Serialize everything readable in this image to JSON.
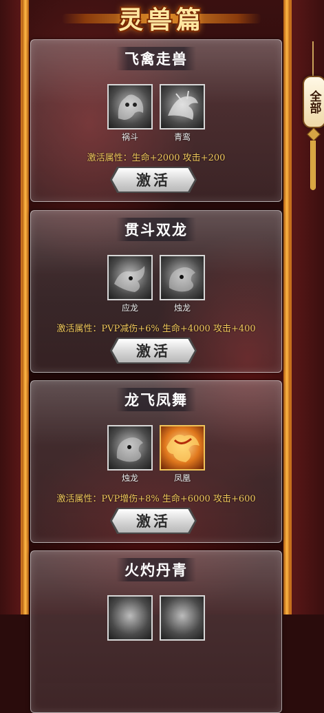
{
  "page_title": "灵兽篇",
  "side_tab": {
    "label": "全部"
  },
  "cards": [
    {
      "title": "飞禽走兽",
      "beasts": [
        {
          "name": "祸斗",
          "icon": "huodou-portrait-icon",
          "rarity": "silver"
        },
        {
          "name": "青鸾",
          "icon": "qingluan-portrait-icon",
          "rarity": "silver"
        }
      ],
      "attr_text": "激活属性：生命+2000 攻击+200",
      "button_label": "激活"
    },
    {
      "title": "贯斗双龙",
      "beasts": [
        {
          "name": "应龙",
          "icon": "yinglong-portrait-icon",
          "rarity": "silver"
        },
        {
          "name": "烛龙",
          "icon": "zhulong-portrait-icon",
          "rarity": "silver"
        }
      ],
      "attr_text": "激活属性：PVP减伤+6% 生命+4000 攻击+400",
      "button_label": "激活"
    },
    {
      "title": "龙飞凤舞",
      "beasts": [
        {
          "name": "烛龙",
          "icon": "zhulong-portrait-icon",
          "rarity": "silver"
        },
        {
          "name": "凤凰",
          "icon": "fenghuang-portrait-icon",
          "rarity": "gold"
        }
      ],
      "attr_text": "激活属性：PVP增伤+8% 生命+6000 攻击+600",
      "button_label": "激活"
    },
    {
      "title": "火灼丹青",
      "beasts": [
        {
          "name": "",
          "icon": "beast-portrait-icon",
          "rarity": "silver"
        },
        {
          "name": "",
          "icon": "beast-portrait-icon",
          "rarity": "silver"
        }
      ],
      "attr_text": "",
      "button_label": ""
    }
  ],
  "colors": {
    "frame_gold": "#ffb845",
    "attr_text": "#f3c95d",
    "background": "#2a0c0c"
  }
}
